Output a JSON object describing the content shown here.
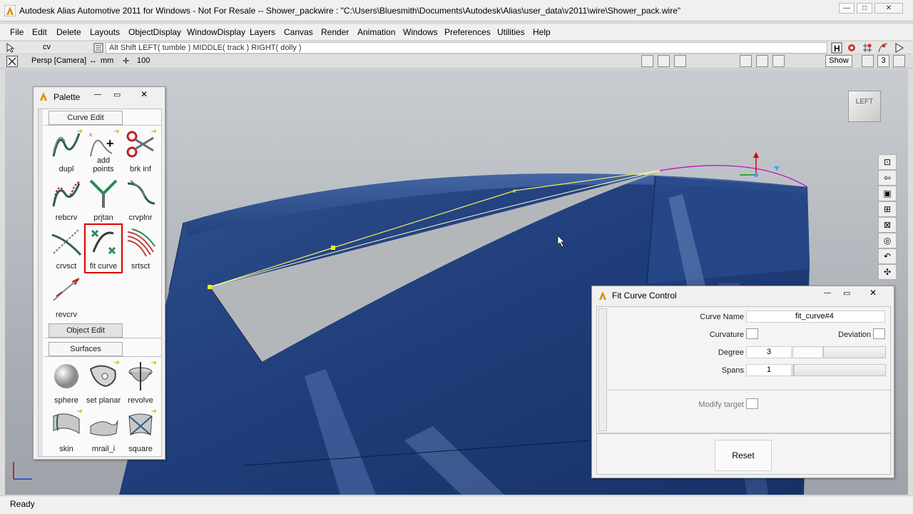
{
  "window": {
    "title": "Autodesk Alias Automotive 2011  for Windows - Not For Resale  --  Shower_packwire : \"C:\\Users\\Bluesmith\\Documents\\Autodesk\\Alias\\user_data\\v2011\\wire\\Shower_pack.wire\"",
    "min_label": "—",
    "max_label": "□",
    "close_label": "✕"
  },
  "menu": {
    "items": [
      "File",
      "Edit",
      "Delete",
      "Layouts",
      "ObjectDisplay",
      "WindowDisplay",
      "Layers",
      "Canvas",
      "Render",
      "Animation",
      "Windows",
      "Preferences",
      "Utilities",
      "Help"
    ]
  },
  "prompt": {
    "pick_mode": "cv",
    "hint": "Alt Shift   LEFT( tumble )   MIDDLE( track )   RIGHT( dolly )"
  },
  "viewbar": {
    "view_name": "Persp [Camera]",
    "units": "mm",
    "scale": "100",
    "show_label": "Show",
    "count": "3"
  },
  "viewcube": {
    "face": "LEFT"
  },
  "palette": {
    "title": "Palette",
    "tabs": {
      "curve_edit": "Curve Edit",
      "object_edit": "Object Edit",
      "surfaces": "Surfaces"
    },
    "curve_tools": [
      "dupl",
      "add points",
      "brk inf",
      "rebcrv",
      "prjtan",
      "crvplnr",
      "crvsct",
      "fit curve",
      "srtsct",
      "revcrv"
    ],
    "surface_tools": [
      "sphere",
      "set planar",
      "revolve",
      "skin",
      "mrail_i",
      "square"
    ],
    "selected_tool": "fit curve"
  },
  "fit_curve": {
    "title": "Fit Curve Control",
    "curve_name_label": "Curve Name",
    "curve_name": "fit_curve#4",
    "curvature_label": "Curvature",
    "deviation_label": "Deviation",
    "degree_label": "Degree",
    "degree": "3",
    "spans_label": "Spans",
    "spans": "1",
    "modify_target_label": "Modify target",
    "reset_label": "Reset",
    "degree_level": 0.33,
    "spans_level": 0.0
  },
  "status": {
    "text": "Ready"
  },
  "colors": {
    "surface_blue": "#1f3f7e",
    "selection_red": "#d00000",
    "curve_magenta": "#c000c0"
  }
}
